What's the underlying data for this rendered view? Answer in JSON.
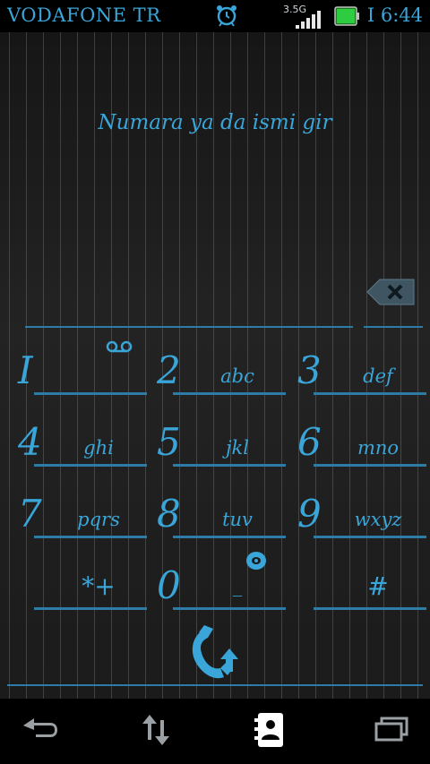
{
  "status_bar": {
    "carrier": "VODAFONE TR",
    "network_type": "3.5G",
    "time": "I 6:44",
    "icons": [
      "alarm-icon",
      "signal-icon",
      "battery-icon"
    ],
    "battery_color": "#2ecc40"
  },
  "dialer": {
    "hint": "Numara ya da ismi gir",
    "accent_color": "#3aa5d8",
    "keys": [
      {
        "digit": "I",
        "letters": ""
      },
      {
        "digit": "2",
        "letters": "abc"
      },
      {
        "digit": "3",
        "letters": "def"
      },
      {
        "digit": "4",
        "letters": "ghi"
      },
      {
        "digit": "5",
        "letters": "jkl"
      },
      {
        "digit": "6",
        "letters": "mno"
      },
      {
        "digit": "7",
        "letters": "pqrs"
      },
      {
        "digit": "8",
        "letters": "tuv"
      },
      {
        "digit": "9",
        "letters": "wxyz"
      },
      {
        "digit": "",
        "letters": "*+"
      },
      {
        "digit": "0",
        "letters": "_"
      },
      {
        "digit": "",
        "letters": "#"
      }
    ],
    "icons": [
      "voicemail-icon",
      "globe-icon",
      "backspace-icon",
      "call-icon"
    ]
  },
  "nav_bar": {
    "icons": [
      "back-icon",
      "data-transfer-icon",
      "contacts-icon",
      "recent-apps-icon"
    ]
  }
}
